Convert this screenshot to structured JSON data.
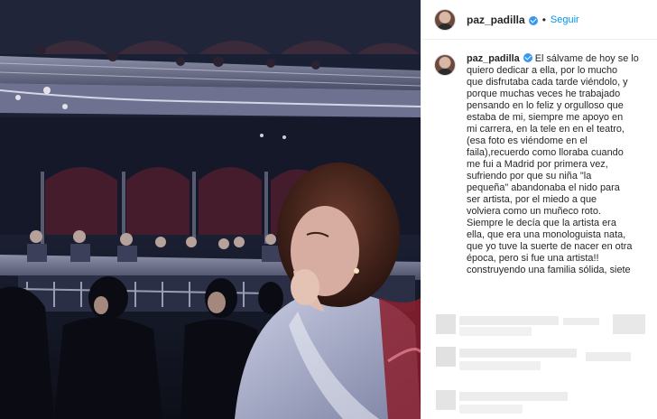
{
  "post": {
    "username": "paz_padilla",
    "follow_label": "Seguir",
    "separator": "•",
    "caption_username": "paz_padilla",
    "caption_text": "El sálvame de hoy se lo\nquiero dedicar a ella, por lo mucho\nque disfrutaba cada tarde viéndolo, y\nporque muchas veces he trabajado\npensando en lo feliz y orgulloso que\nestaba de mi, siempre me apoyo en\nmi carrera, en la tele en en el teatro,\n(esa foto es viéndome en el\nfaila),recuerdo como lloraba cuando\nme fui a Madrid por primera vez,\nsufriendo por que su niña \"la\npequeña\" abandonaba el nido para\nser artista, por el miedo a que\nvolviera como un muñeco roto.\nSiempre le decía que la artista era\nella, que era una monologuista nata,\nque yo tuve la suerte de nacer en otra\népoca, pero si fue una artista!!\nconstruyendo una familia sólida, siete"
  },
  "icons": {
    "verified": "verified-badge-icon",
    "avatar": "profile-avatar"
  },
  "colors": {
    "link": "#0095f6",
    "verified": "#3897f0",
    "text": "#262626"
  }
}
